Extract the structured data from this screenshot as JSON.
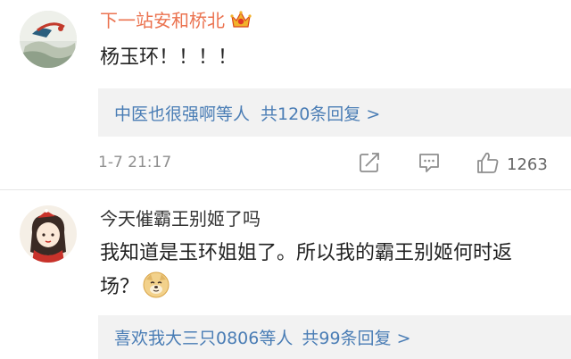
{
  "comments": [
    {
      "username": "下一站安和桥北",
      "text": "杨玉环！！！！",
      "replies": {
        "names": "中医也很强啊等人",
        "count": "共120条回复 >"
      },
      "timestamp": "1-7 21:17",
      "likes": "1263",
      "icons": {
        "vip": "crown-icon",
        "share": "share-icon",
        "comment": "comment-icon",
        "like": "thumbs-up-icon"
      }
    },
    {
      "username": "今天催霸王别姬了吗",
      "text": "我知道是玉环姐姐了。所以我的霸王别姬何时返场？",
      "emoji": "doge-emoji",
      "replies": {
        "names": "喜欢我大三只0806等人",
        "count": "共99条回复 >"
      }
    }
  ],
  "colors": {
    "accent": "#eb7350",
    "link": "#4a7db5",
    "meta": "#8f8f8f",
    "reply_bg": "#f2f2f2"
  }
}
